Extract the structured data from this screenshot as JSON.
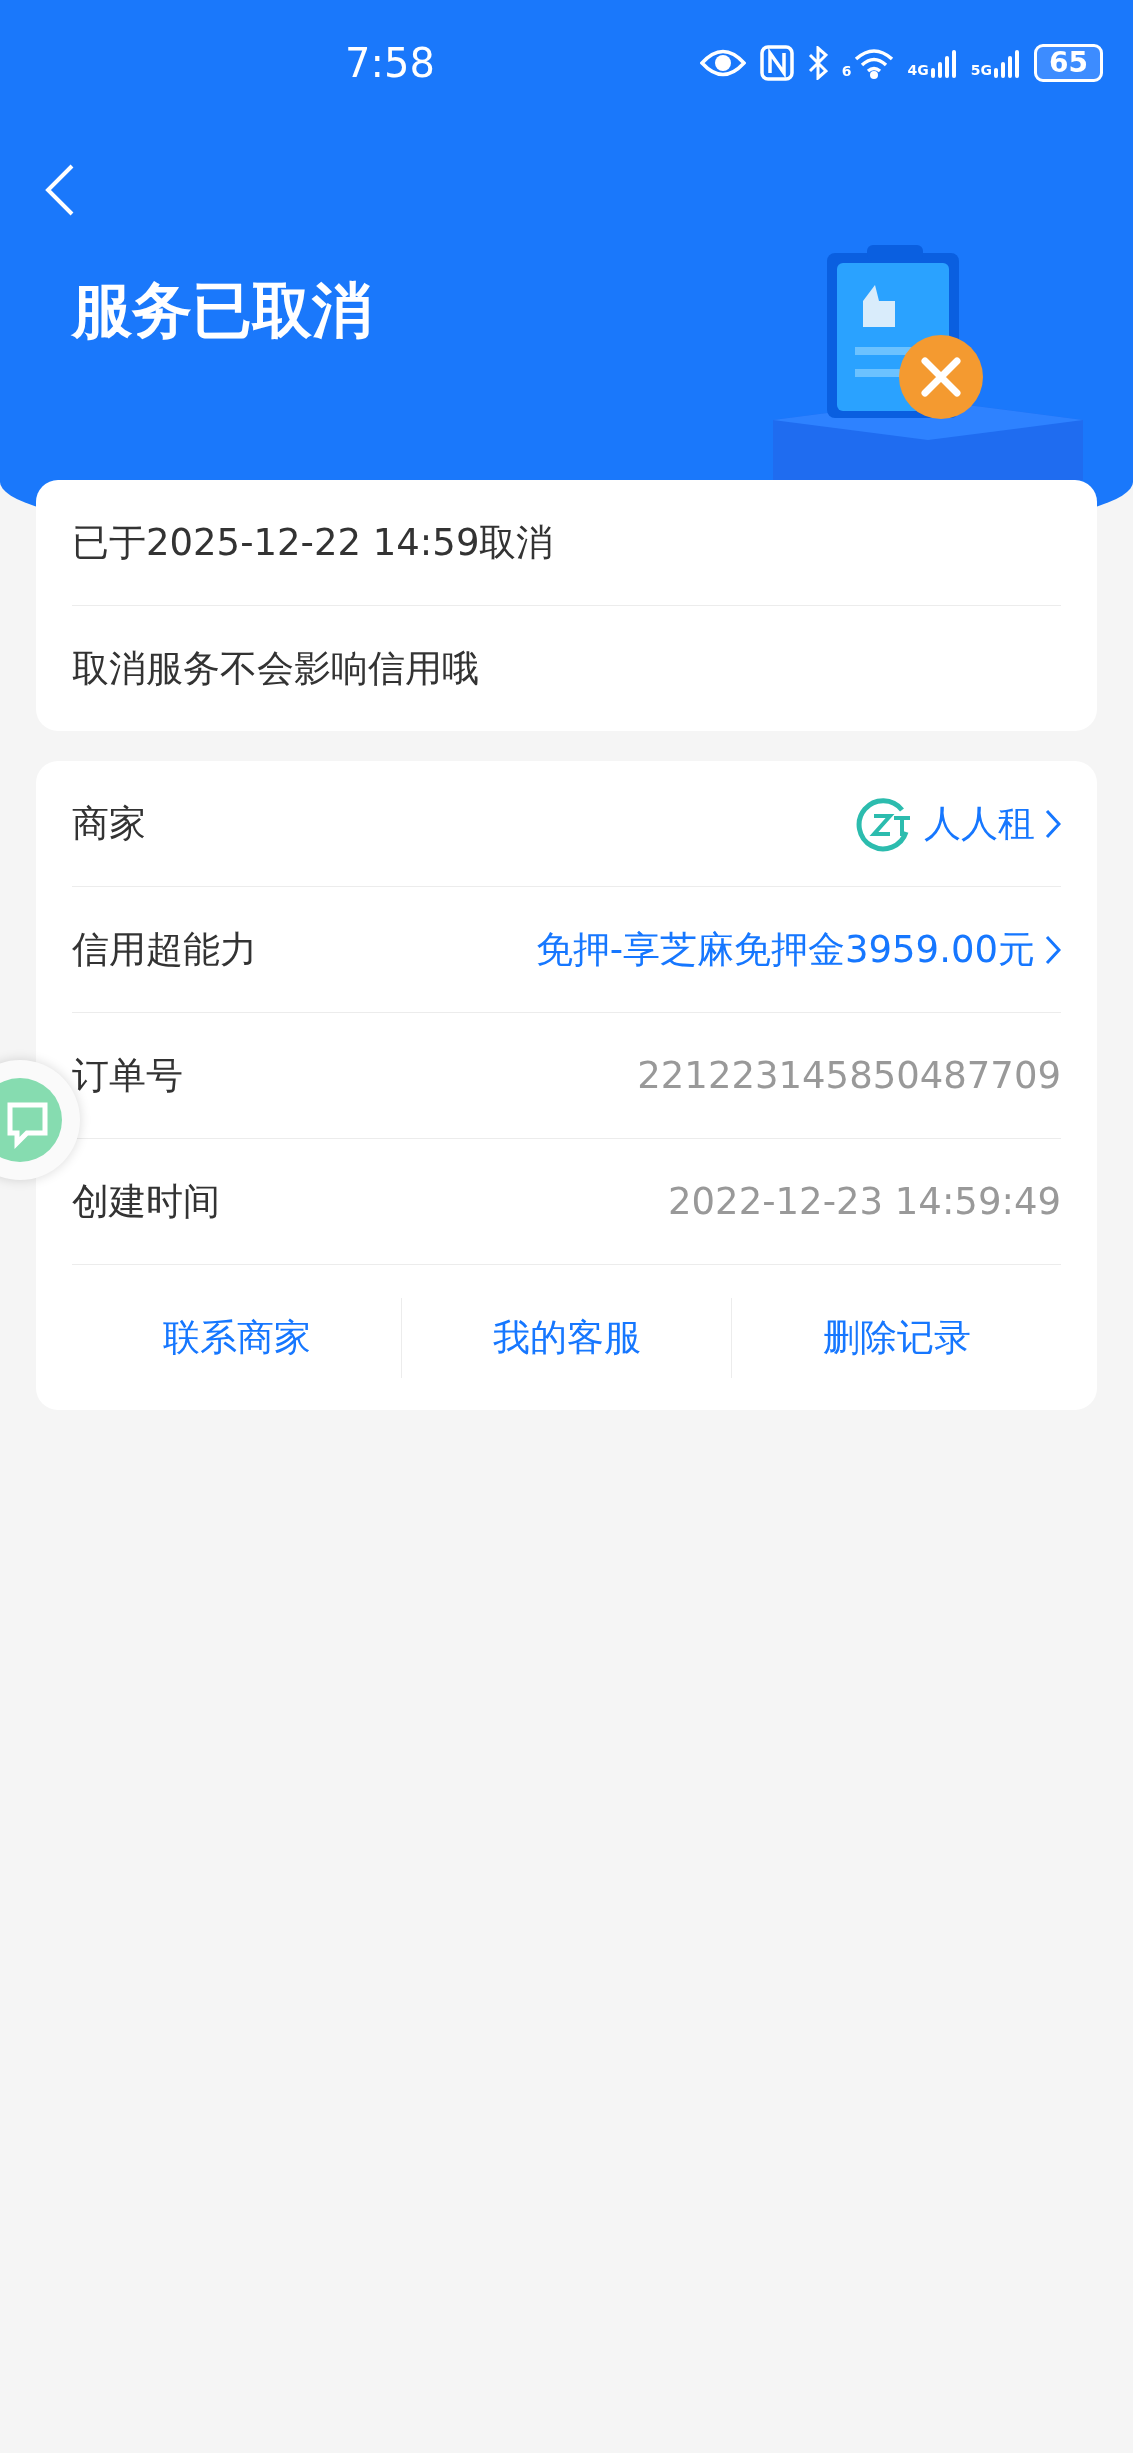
{
  "status_bar": {
    "time": "7:58",
    "wifi_label": "6",
    "signals": [
      {
        "label": "4G"
      },
      {
        "label": "5G"
      }
    ],
    "battery": "65"
  },
  "header": {
    "title": "服务已取消"
  },
  "notice": {
    "lines": [
      "已于2025-12-22 14:59取消",
      "取消服务不会影响信用哦"
    ]
  },
  "details": {
    "rows": [
      {
        "kind": "merchant",
        "label": "商家",
        "value": "人人租"
      },
      {
        "kind": "link",
        "label": "信用超能力",
        "value": "免押-享芝麻免押金3959.00元"
      },
      {
        "kind": "plain",
        "label": "订单号",
        "value": "221223145850487709"
      },
      {
        "kind": "plain",
        "label": "创建时间",
        "value": "2022-12-23 14:59:49"
      }
    ],
    "actions": [
      "联系商家",
      "我的客服",
      "删除记录"
    ]
  }
}
